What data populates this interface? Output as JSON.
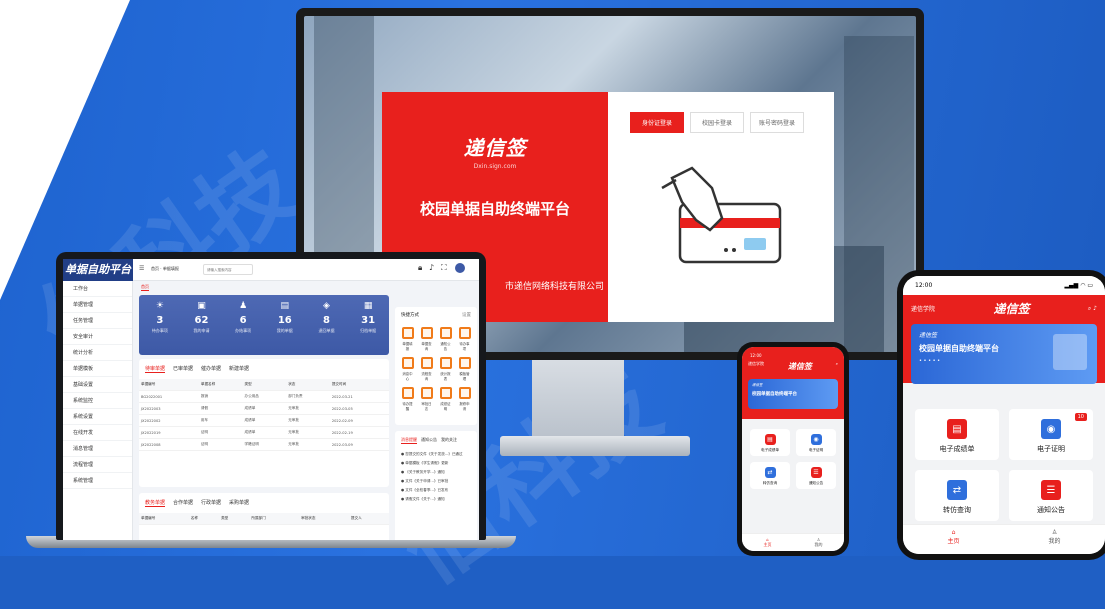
{
  "watermark": "信科技",
  "monitor": {
    "logo": "递信签",
    "logo_sub": "Dxin.sign.com",
    "title": "校园单据自助终端平台",
    "company": "市递信网络科技有限公司",
    "tabs": [
      "身份证登录",
      "校园卡登录",
      "账号密码登录"
    ]
  },
  "laptop": {
    "brand": "单据自助平台",
    "breadcrumb": [
      "首页",
      "单据填报"
    ],
    "search_placeholder": "请输入搜索内容",
    "active_tab": "首页",
    "nav": [
      "工作台",
      "单据管理",
      "任务管理",
      "安全审计",
      "统计分析",
      "单据模板",
      "基础设置",
      "系统监控",
      "系统设置",
      "在线开发",
      "消息管理",
      "流程管理",
      "系统管理"
    ],
    "stats": [
      {
        "icon": "☀",
        "num": "3",
        "label": "待办事项"
      },
      {
        "icon": "▣",
        "num": "62",
        "label": "我的申请"
      },
      {
        "icon": "♟",
        "num": "6",
        "label": "办结事项"
      },
      {
        "icon": "▤",
        "num": "16",
        "label": "我的单据"
      },
      {
        "icon": "◈",
        "num": "8",
        "label": "退回单据"
      },
      {
        "icon": "▦",
        "num": "31",
        "label": "归档单据"
      }
    ],
    "table1": {
      "tabs": [
        "待审单据",
        "已审单据",
        "催办单据",
        "新建单据"
      ],
      "headers": [
        "单据编号",
        "单据名称",
        "类型",
        "状态",
        "提交时间"
      ],
      "rows": [
        [
          "BG2022001",
          "报销",
          "办公用品",
          "部门负责",
          "2022-03-21"
        ],
        [
          "JX2022003",
          "请假",
          "成绩单",
          "无审批",
          "2022-03-05"
        ],
        [
          "JX2022002",
          "用车",
          "成绩单",
          "无审批",
          "2022-02-09"
        ],
        [
          "JX2022019",
          "证明",
          "成绩单",
          "无审批",
          "2022-02-19"
        ],
        [
          "JX2022008",
          "证明",
          "学籍证明",
          "无审批",
          "2022-03-09"
        ]
      ]
    },
    "table2": {
      "tabs": [
        "教务单据",
        "合作单据",
        "行政单据",
        "采购单据"
      ],
      "headers": [
        "单据编号",
        "名称",
        "类型",
        "所属部门",
        "审批状态",
        "提交人"
      ]
    },
    "quick": {
      "title": "快捷方式",
      "more": "设置",
      "items": [
        "单据填报",
        "单据查询",
        "通知公告",
        "待办事项",
        "消息中心",
        "流程查询",
        "统计报表",
        "模板管理",
        "待办提醒",
        "审批日志",
        "成绩证明",
        "报修申请"
      ]
    },
    "notices": {
      "tabs": [
        "消息提醒",
        "通知公告",
        "我的关注"
      ],
      "items": [
        "您提交的文件《关于发放...》已通过",
        "单据模板《学生请假》更新",
        "《关于教务开学...》通知",
        "文件《关于申请...》已审批",
        "文件《全校春季...》已发布",
        "请假文件《关于...》通知"
      ]
    }
  },
  "phone_small": {
    "time": "12:00",
    "school": "递信学院",
    "logo": "递信签",
    "banner_tag": "递信签",
    "banner_title": "校园单据自助终端平台",
    "tiles": [
      "电子成绩单",
      "电子证明",
      "转仿查询",
      "通知公告"
    ],
    "tabbar": [
      "主页",
      "我的"
    ]
  },
  "phone_large": {
    "time": "12:00",
    "school": "递信学院",
    "logo": "递信签",
    "banner_tag": "递信签",
    "banner_title": "校园单据自助终端平台",
    "banner_dots": "• • • • •",
    "badge": "10",
    "tiles": [
      "电子成绩单",
      "电子证明",
      "转仿查询",
      "通知公告"
    ],
    "tabbar": [
      "主页",
      "我的"
    ]
  }
}
